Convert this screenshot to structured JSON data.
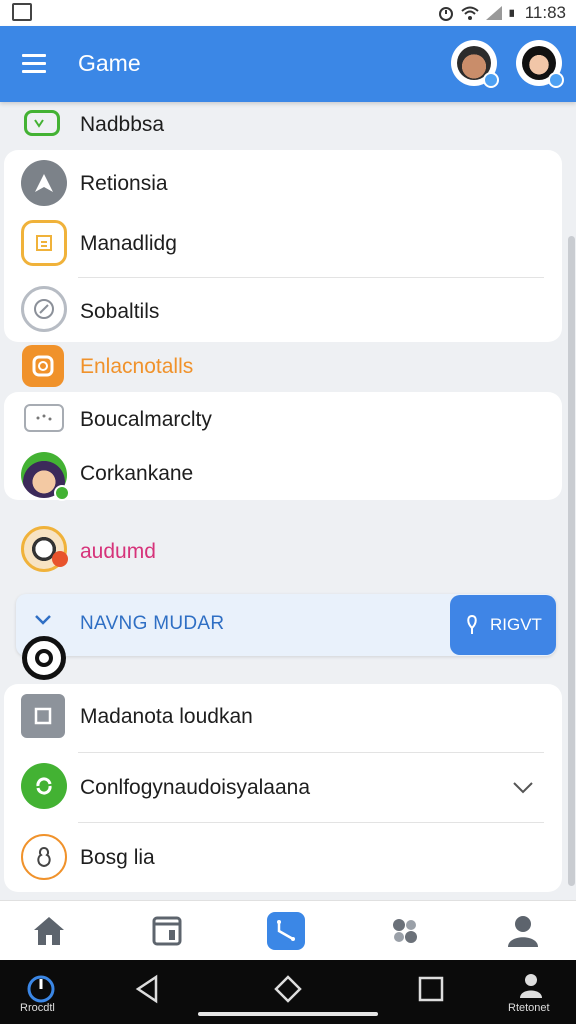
{
  "status_bar": {
    "time": "11:83"
  },
  "app_bar": {
    "title": "Game"
  },
  "rows": [
    {
      "label": "Nadbbsa",
      "icon": "tv-icon"
    },
    {
      "label": "Retionsia",
      "icon": "navigation-arrow-icon"
    },
    {
      "label": "Manadlidg",
      "icon": "document-icon"
    },
    {
      "label": "Sobaltils",
      "icon": "circle-link-icon"
    },
    {
      "label": "Enlacnotalls",
      "icon": "orange-app-icon"
    },
    {
      "label": "Boucalmarclty",
      "icon": "dotted-box-icon"
    },
    {
      "label": "Corkankane",
      "icon": "character-avatar-icon"
    },
    {
      "label": "audumd",
      "icon": "panda-avatar-icon"
    },
    {
      "label": "Madanota loudkan",
      "icon": "square-icon"
    },
    {
      "label": "Conlfogynaudoisyalaana",
      "icon": "green-sync-icon"
    },
    {
      "label": "Bosg lia",
      "icon": "bag-icon"
    }
  ],
  "banner": {
    "label": "NAVNG MUDAR",
    "button_label": "RIGVT"
  },
  "bottom_nav": [
    "home-icon",
    "book-icon",
    "route-icon",
    "gear-cluster-icon",
    "person-icon"
  ],
  "system_nav": {
    "left_label": "Rrocdtl",
    "right_label": "Rtetonet"
  },
  "colors": {
    "accent": "#3b87e6",
    "orange": "#f0922b",
    "magenta": "#d6337a",
    "green": "#43b233"
  }
}
